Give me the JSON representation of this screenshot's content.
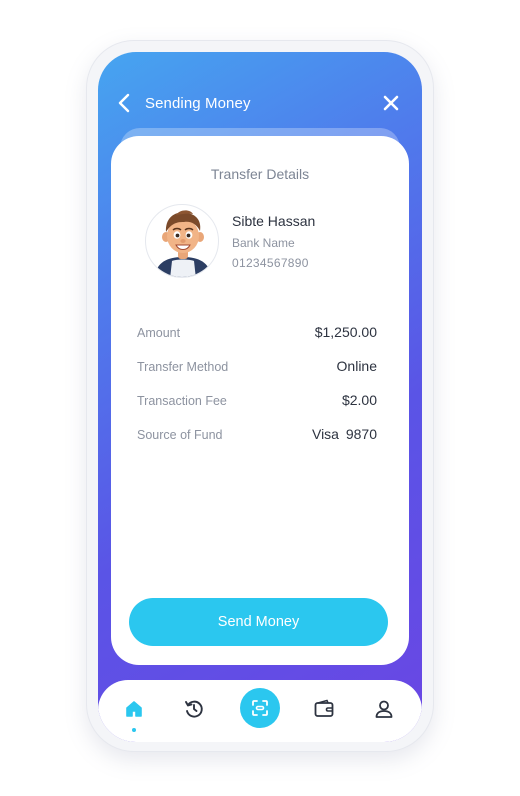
{
  "header": {
    "title": "Sending Money"
  },
  "card": {
    "title": "Transfer Details",
    "recipient": {
      "name": "Sibte Hassan",
      "bank": "Bank Name",
      "account": "01234567890"
    },
    "details": [
      {
        "label": "Amount",
        "value": "$1,250.00"
      },
      {
        "label": "Transfer Method",
        "value": "Online"
      },
      {
        "label": "Transaction Fee",
        "value": "$2.00"
      },
      {
        "label": "Source of Fund",
        "value": "Visa 9870"
      }
    ],
    "send_button": "Send Money"
  },
  "nav": {
    "items": [
      {
        "icon": "home-icon",
        "active": true
      },
      {
        "icon": "history-icon",
        "active": false
      },
      {
        "icon": "scan-icon",
        "active": false
      },
      {
        "icon": "wallet-icon",
        "active": false
      },
      {
        "icon": "user-icon",
        "active": false
      }
    ]
  },
  "colors": {
    "accent": "#2bc7ef",
    "gradient_start": "#46a5f0",
    "gradient_end": "#6a46e4",
    "text_dark": "#2d3340",
    "text_muted": "#8d93a0"
  }
}
